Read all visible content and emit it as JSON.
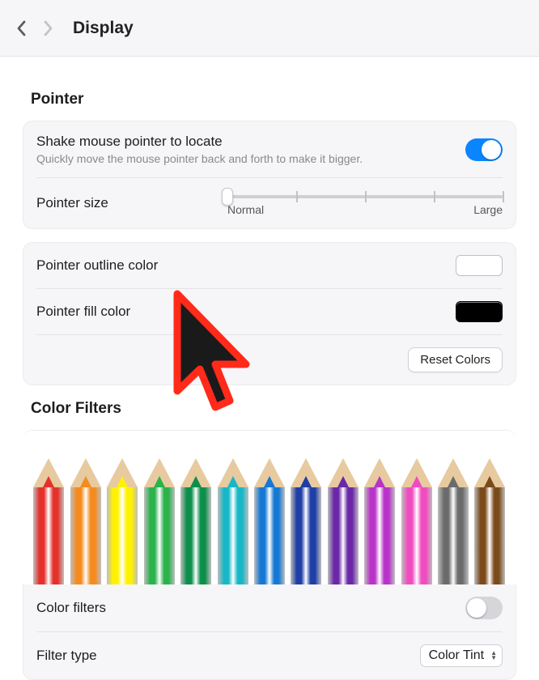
{
  "header": {
    "title": "Display"
  },
  "sections": {
    "pointer": {
      "heading": "Pointer",
      "shake": {
        "title": "Shake mouse pointer to locate",
        "subtitle": "Quickly move the mouse pointer back and forth to make it bigger.",
        "enabled": true
      },
      "size": {
        "label": "Pointer size",
        "min_label": "Normal",
        "max_label": "Large",
        "value": 0
      },
      "outline_label": "Pointer outline color",
      "outline_color": "#ffffff",
      "fill_label": "Pointer fill color",
      "fill_color": "#000000",
      "reset_button": "Reset Colors"
    },
    "filters": {
      "heading": "Color Filters",
      "toggle_label": "Color filters",
      "toggle_enabled": false,
      "type_label": "Filter type",
      "type_value": "Color Tint",
      "pencil_colors": [
        "#e4312b",
        "#f58b1f",
        "#fef200",
        "#2bb24b",
        "#0c8f4b",
        "#17b7c7",
        "#1578d4",
        "#1f3ea6",
        "#6a28a8",
        "#b833c8",
        "#f04cc0",
        "#6b6b6b",
        "#7a4a1a"
      ]
    }
  },
  "colors": {
    "accent": "#0a85ff"
  }
}
